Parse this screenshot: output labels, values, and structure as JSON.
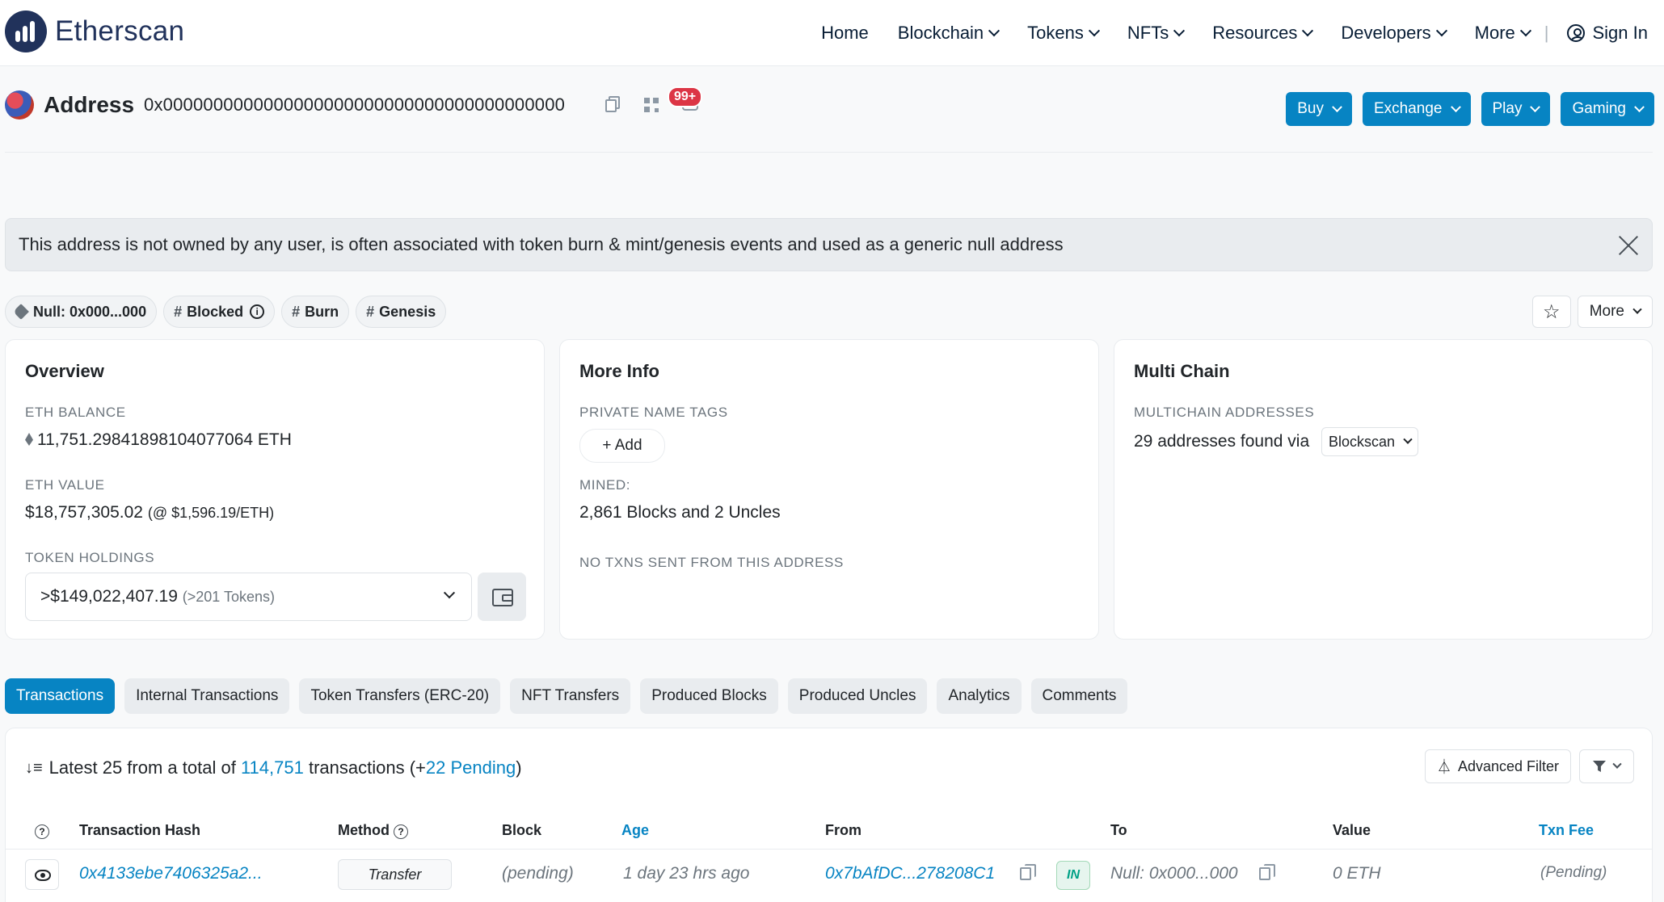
{
  "brand": {
    "name": "Etherscan"
  },
  "nav": {
    "home": "Home",
    "blockchain": "Blockchain",
    "tokens": "Tokens",
    "nfts": "NFTs",
    "resources": "Resources",
    "developers": "Developers",
    "more": "More",
    "separator": "|",
    "sign_in": "Sign In"
  },
  "address": {
    "label": "Address",
    "hash": "0x0000000000000000000000000000000000000000",
    "comment_count": "99+"
  },
  "sponsor_buttons": {
    "buy": "Buy",
    "exchange": "Exchange",
    "play": "Play",
    "gaming": "Gaming"
  },
  "alert": {
    "text": "This address is not owned by any user, is often associated with token burn & mint/genesis events and used as a generic null address"
  },
  "tags": {
    "name": "Null: 0x000...000",
    "blocked": "Blocked",
    "burn": "Burn",
    "genesis": "Genesis",
    "hash_symbol": "#",
    "info_symbol": "i"
  },
  "more_button": "More",
  "star_symbol": "☆",
  "overview": {
    "title": "Overview",
    "eth_balance_label": "ETH BALANCE",
    "eth_balance": "11,751.29841898104077064 ETH",
    "eth_value_label": "ETH VALUE",
    "eth_value": "$18,757,305.02",
    "eth_price": "(@ $1,596.19/ETH)",
    "token_holdings_label": "TOKEN HOLDINGS",
    "token_holdings_value": ">$149,022,407.19",
    "token_holdings_count": "(>201 Tokens)"
  },
  "more_info": {
    "title": "More Info",
    "private_tags_label": "PRIVATE NAME TAGS",
    "add_button": "+ Add",
    "mined_label": "MINED:",
    "mined_value": "2,861 Blocks and 2 Uncles",
    "no_txns": "NO TXNS SENT FROM THIS ADDRESS"
  },
  "multi_chain": {
    "title": "Multi Chain",
    "label": "MULTICHAIN ADDRESSES",
    "value": "29 addresses found via",
    "blockscan": "Blockscan"
  },
  "tabs": [
    "Transactions",
    "Internal Transactions",
    "Token Transfers (ERC-20)",
    "NFT Transfers",
    "Produced Blocks",
    "Produced Uncles",
    "Analytics",
    "Comments"
  ],
  "txn_summary": {
    "prefix": "Latest 25 from a total of",
    "total": "114,751",
    "middle": "transactions (+",
    "pending": "22 Pending",
    "suffix": ")"
  },
  "advanced_filter": "Advanced Filter",
  "table": {
    "help_symbol": "?",
    "headers": {
      "hash": "Transaction Hash",
      "method": "Method",
      "block": "Block",
      "age": "Age",
      "from": "From",
      "to": "To",
      "value": "Value",
      "fee": "Txn Fee"
    },
    "rows": [
      {
        "hash": "0x4133ebe7406325a2...",
        "method": "Transfer",
        "block": "(pending)",
        "age": "1 day 23 hrs ago",
        "from": "0x7bAfDC...278208C1",
        "direction": "IN",
        "to": "Null: 0x000...000",
        "value": "0 ETH",
        "fee": "(Pending)"
      }
    ]
  },
  "colors": {
    "accent": "#0784c3",
    "brand": "#21325b",
    "badge_red": "#dc3545",
    "in_green": "#00a186"
  }
}
